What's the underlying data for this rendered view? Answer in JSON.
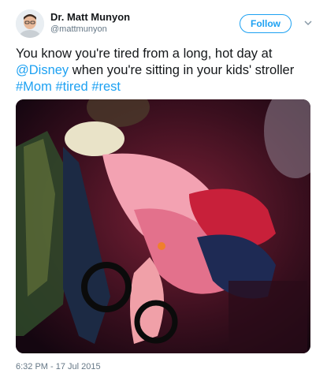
{
  "user": {
    "display_name": "Dr. Matt Munyon",
    "handle": "@mattmunyon"
  },
  "follow_label": "Follow",
  "tweet": {
    "text_part1": "You know you're tired from a long, hot day at",
    "mention": "@Disney",
    "text_part2": " when you're sitting in your kids' stroller ",
    "hashtags": [
      "#Mom",
      "#tired",
      "#rest"
    ]
  },
  "timestamp": "6:32 PM - 17 Jul 2015",
  "colors": {
    "accent": "#1da1f2",
    "text": "#14171a",
    "muted": "#657786"
  },
  "icons": {
    "menu": "chevron-down-icon"
  }
}
